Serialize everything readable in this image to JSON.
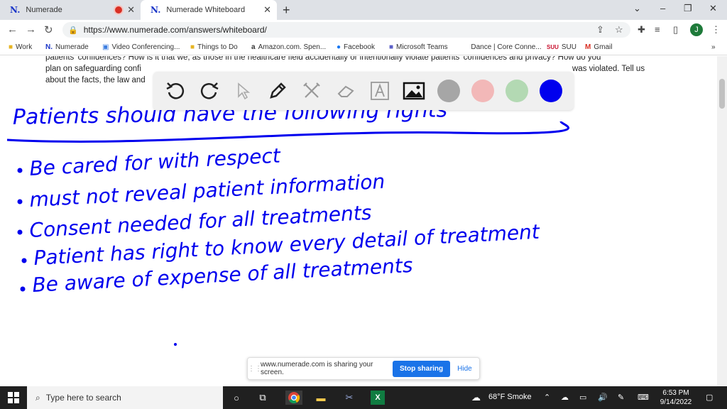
{
  "browser": {
    "tabs": [
      {
        "label": "Numerade",
        "logo": "N."
      },
      {
        "label": "Numerade Whiteboard",
        "logo": "N."
      }
    ],
    "new_tab": "+",
    "window_controls": {
      "minimize": "–",
      "restore": "❐",
      "close": "✕",
      "tab_search": "⌄"
    },
    "url": "https://www.numerade.com/answers/whiteboard/",
    "profile_initial": "J"
  },
  "bookmarks": [
    {
      "label": "Work",
      "icon": "folder-icon"
    },
    {
      "label": "Numerade",
      "icon": "numerade-icon"
    },
    {
      "label": "Video Conferencing...",
      "icon": "video-icon"
    },
    {
      "label": "Things to Do",
      "icon": "folder-icon"
    },
    {
      "label": "Amazon.com. Spen...",
      "icon": "amazon-icon"
    },
    {
      "label": "Facebook",
      "icon": "facebook-icon"
    },
    {
      "label": "Microsoft Teams",
      "icon": "teams-icon"
    },
    {
      "label": "Dance | Core Conne...",
      "icon": "blank-icon"
    },
    {
      "label": "SUU",
      "icon": "suu-icon"
    },
    {
      "label": "Gmail",
      "icon": "gmail-icon"
    }
  ],
  "bookmarks_more": "»",
  "question_text": {
    "line1": "patients' confidences? How is it that we, as those in the healthcare field accidentally or intentionally violate patients' confidences and privacy? How do you",
    "line2": "plan on safeguarding confi",
    "line2_end": "was violated. Tell us",
    "line3": "about the facts, the law and"
  },
  "whiteboard": {
    "colors": [
      "#a6a6a6",
      "#f2b8b8",
      "#b3d9b3",
      "#0000ee"
    ],
    "handwriting_color": "#0000ee",
    "title": "Patients should have the following rights",
    "bullets": [
      "Be cared for with respect",
      "must not reveal patient information",
      "Consent needed for all treatments",
      "Patient has right to know every detail of treatment",
      "Be aware of expense of all treatments"
    ]
  },
  "share_bar": {
    "message": "www.numerade.com is sharing your screen.",
    "stop_label": "Stop sharing",
    "hide_label": "Hide"
  },
  "taskbar": {
    "search_placeholder": "Type here to search",
    "weather": "68°F Smoke",
    "time": "6:53 PM",
    "date": "9/14/2022"
  }
}
